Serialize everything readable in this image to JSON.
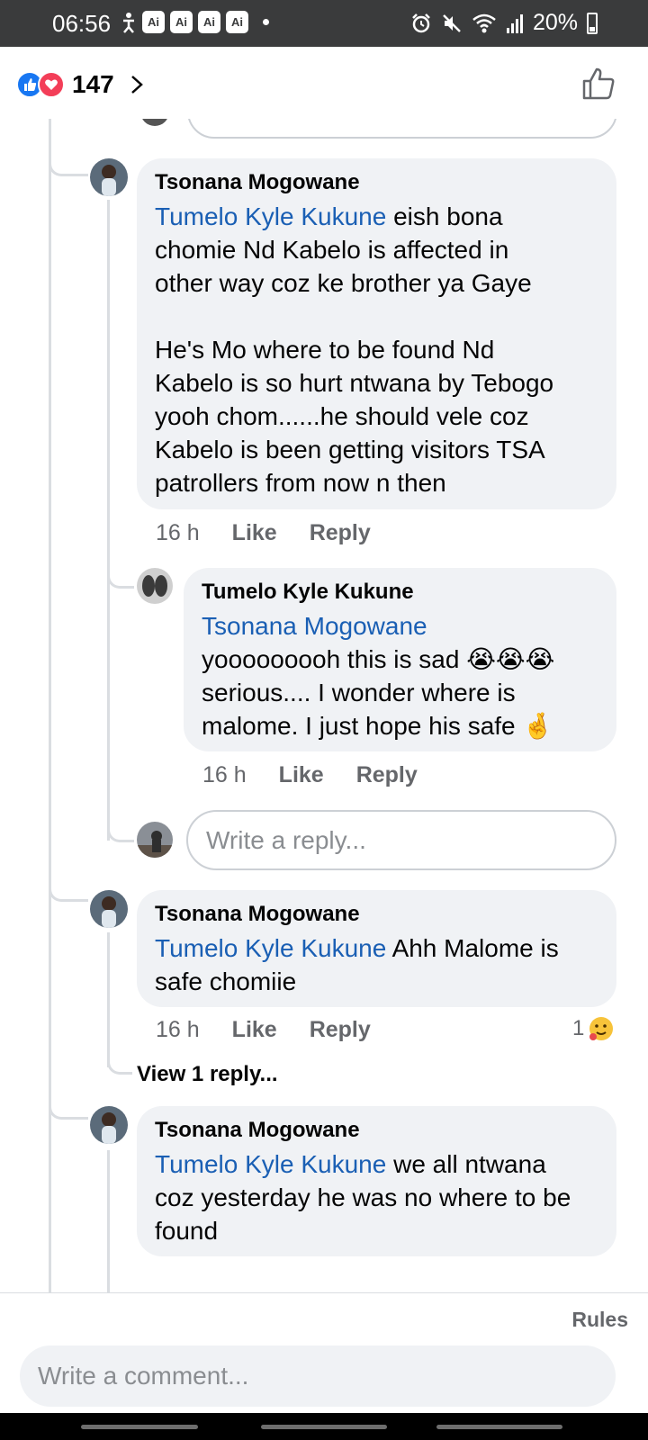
{
  "status_bar": {
    "time": "06:56",
    "badges": [
      "Ai",
      "Ai",
      "Ai",
      "Ai"
    ],
    "battery": "20%"
  },
  "header": {
    "reaction_count": "147",
    "reaction_icons": [
      "like-icon",
      "love-icon"
    ]
  },
  "comments": [
    {
      "author": "Tsonana Mogowane",
      "mention": "Tumelo Kyle Kukune",
      "text": " eish bona\nchomie Nd Kabelo is affected in\nother way coz ke brother ya Gaye\n\nHe's Mo where to be found Nd\nKabelo is so hurt ntwana by Tebogo\nyooh chom......he should vele coz\nKabelo is been getting visitors TSA\npatrollers from now n then",
      "age": "16 h",
      "like": "Like",
      "reply": "Reply"
    },
    {
      "author": "Tumelo Kyle Kukune",
      "mention": "Tsonana Mogowane",
      "text": "\nyooooooooh this is sad 😭😭😭\nserious.... I wonder where is\nmalome. I just hope his safe 🤞",
      "age": "16 h",
      "like": "Like",
      "reply": "Reply"
    },
    {
      "author": "Tsonana Mogowane",
      "mention": "Tumelo Kyle Kukune",
      "text": " Ahh Malome is\nsafe chomiie",
      "age": "16 h",
      "like": "Like",
      "reply": "Reply",
      "reaction_count": "1",
      "reaction_icon": "hug-emoji-icon"
    },
    {
      "author": "Tsonana Mogowane",
      "mention": "Tumelo Kyle Kukune",
      "text": " we all ntwana\ncoz yesterday he was no where to be\nfound"
    }
  ],
  "reply_placeholder": "Write a reply...",
  "view_replies": "View 1 reply...",
  "footer": {
    "rules": "Rules",
    "comment_placeholder": "Write a comment..."
  }
}
